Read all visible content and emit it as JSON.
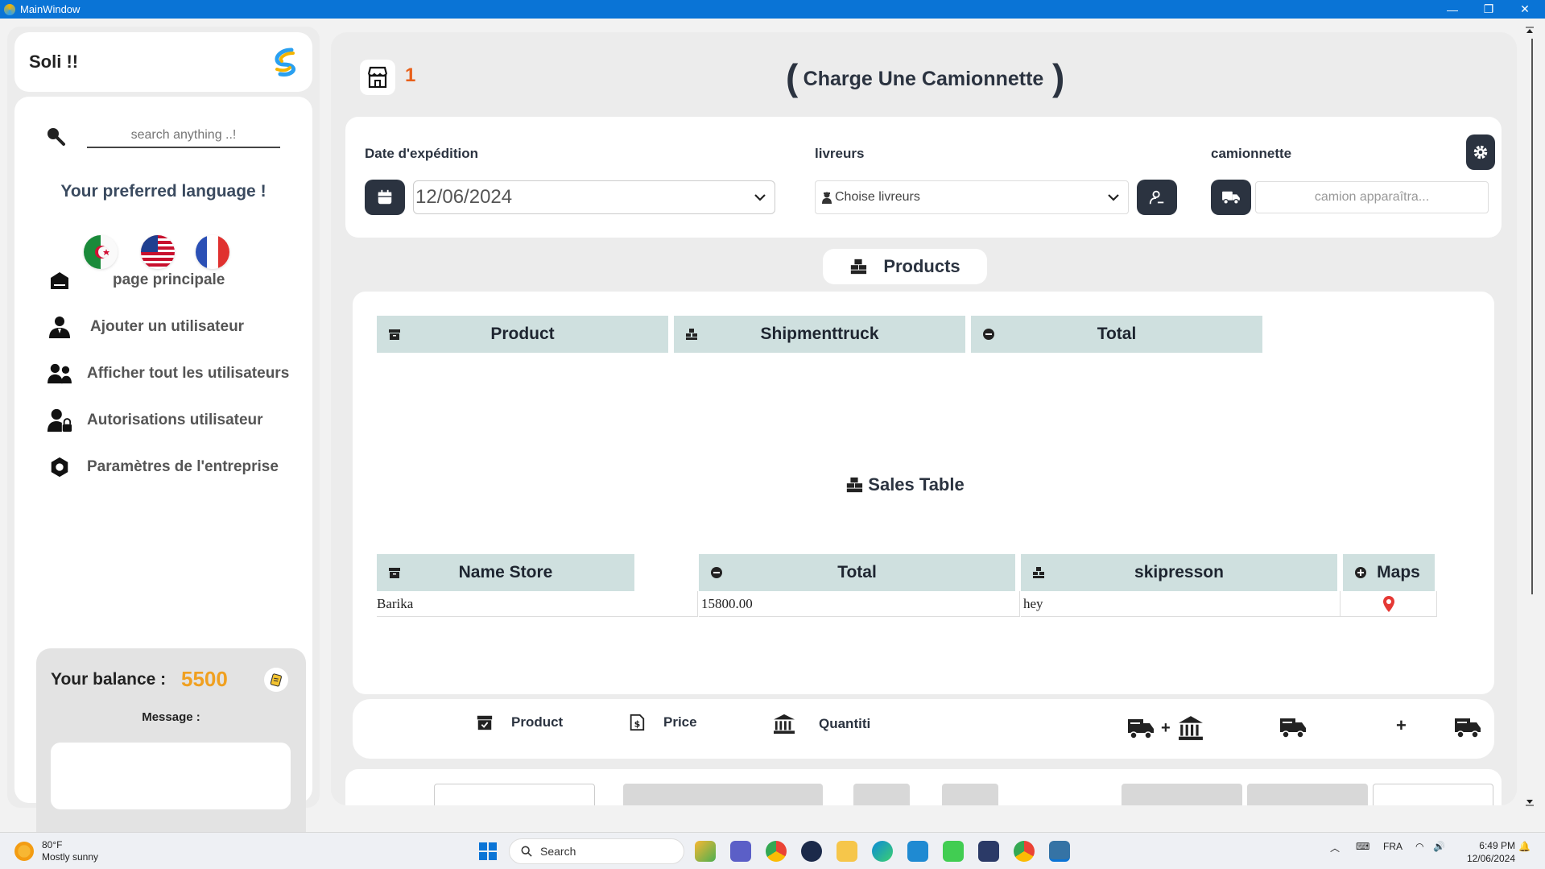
{
  "window": {
    "title": "MainWindow",
    "min": "—",
    "max": "❐",
    "close": "✕"
  },
  "sidebar": {
    "brand": "Soli !!",
    "search_placeholder": "search anything ..!",
    "language_title": "Your preferred language !",
    "flags": [
      "algeria-flag",
      "usa-flag",
      "france-flag"
    ],
    "nav": [
      {
        "label": "page principale",
        "icon": "home-icon"
      },
      {
        "label": "Ajouter un utilisateur",
        "icon": "add-user-icon"
      },
      {
        "label": "Afficher tout les utilisateurs",
        "icon": "users-icon"
      },
      {
        "label": "Autorisations utilisateur",
        "icon": "user-lock-icon"
      },
      {
        "label": "Paramètres de l'entreprise",
        "icon": "settings-icon"
      }
    ],
    "balance_label": "Your balance :",
    "balance_value": "5500",
    "message_label": "Message :"
  },
  "header": {
    "store_count": "1",
    "title": "Charge Une Camionnette"
  },
  "form": {
    "date_label": "Date d'expédition",
    "date_value": "12/06/2024",
    "drivers_label": "livreurs",
    "drivers_value": "Choise  livreurs",
    "truck_label": "camionnette",
    "truck_placeholder": "camion apparaîtra..."
  },
  "products_section": {
    "title": "Products",
    "columns": [
      "Product",
      "Shipmenttruck",
      "Total"
    ]
  },
  "sales_section": {
    "title": "Sales Table",
    "columns": [
      "Name Store",
      "Total",
      "skipresson",
      "Maps"
    ],
    "rows": [
      {
        "store": "Barika",
        "total": "15800.00",
        "skip": "hey"
      }
    ]
  },
  "toolbar": {
    "product": "Product",
    "price": "Price",
    "quantity": "Quantiti",
    "plus": "+"
  },
  "taskbar": {
    "weather_temp": "80°F",
    "weather_desc": "Mostly sunny",
    "search": "Search",
    "lang": "FRA",
    "time": "6:49 PM",
    "date": "12/06/2024"
  },
  "colors": {
    "accent": "#2b3340",
    "orange": "#e8601a",
    "balance": "#f0a020",
    "table_header": "#cfe0df",
    "titlebar": "#0a74d6"
  }
}
